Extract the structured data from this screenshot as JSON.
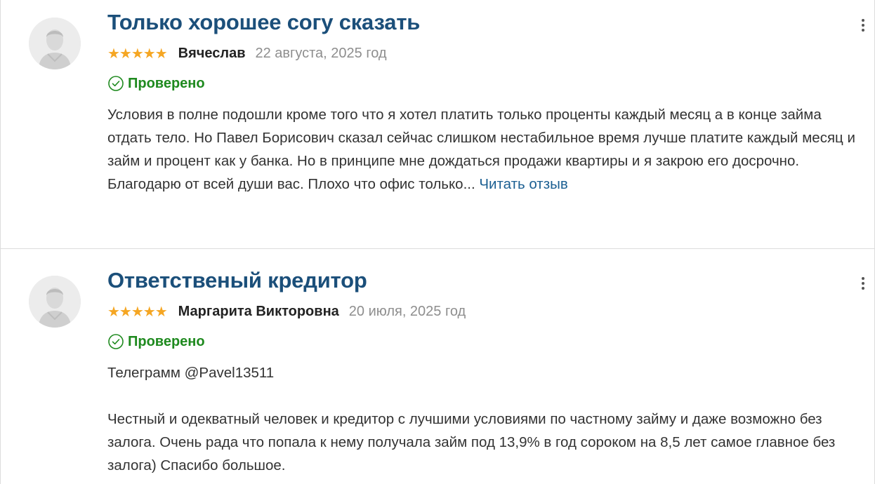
{
  "reviews": [
    {
      "title": "Только хорошее согу сказать",
      "stars": "★★★★★",
      "rating": 5,
      "author": "Вячеслав",
      "date": "22 августа, 2025 год",
      "verified": "Проверено",
      "text": "Условия в полне подошли кроме того что я хотел платить только проценты каждый месяц а в конце займа отдать тело. Но Павел Борисович сказал сейчас слишком нестабильное время лучше платите каждый месяц и займ и процент как у банка. Но в принципе мне дождаться продажи квартиры и я закрою его досрочно. Благодарю от всей души вас. Плохо что офис только...",
      "read_more": "Читать отзыв"
    },
    {
      "title": "Ответственый кредитор",
      "stars": "★★★★★",
      "rating": 5,
      "author": "Маргарита Викторовна",
      "date": "20 июля, 2025 год",
      "verified": "Проверено",
      "line1": "Телеграмм @Pavel13511",
      "line2": "Честный и одекватный человек и кредитор с лучшими условиями по частному займу и даже возможно без залога. Очень рада что попала к нему получала займ под 13,9% в год сороком на 8,5 лет самое главное без залога) Спасибо большое."
    }
  ],
  "colors": {
    "title": "#1b4f7a",
    "star": "#f5a623",
    "verified": "#1f8a1f",
    "link": "#1b5f92",
    "date": "#8e8e8e"
  },
  "icons": {
    "avatar": "user-avatar-icon",
    "verified": "check-circle-icon",
    "menu": "more-vertical-icon"
  }
}
